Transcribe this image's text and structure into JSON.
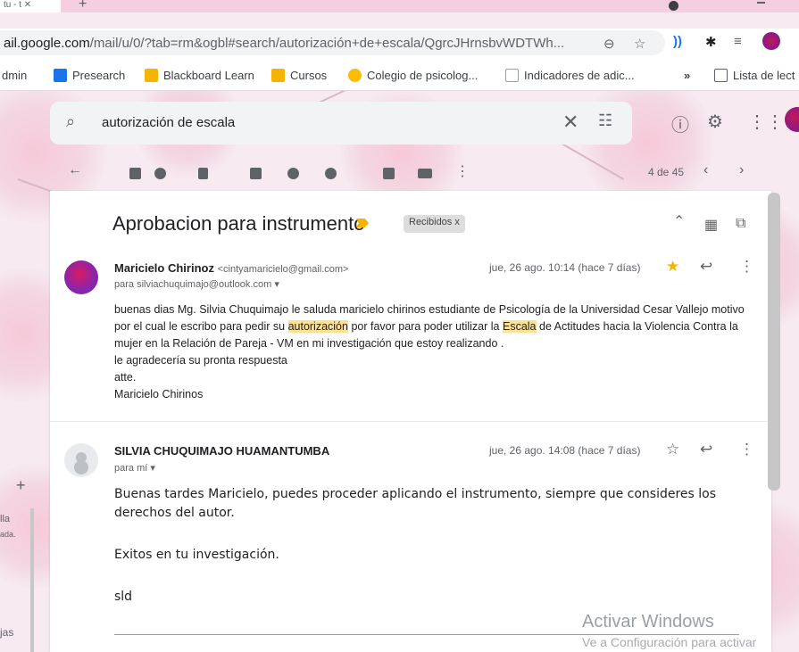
{
  "browser": {
    "tab_title": "tu - t",
    "url_host": "ail.google.com",
    "url_path": "/mail/u/0/?tab=rm&ogbl#search/autorización+de+escala/QgrcJHrnsbvWDTWh..."
  },
  "bookmarks": [
    {
      "label": "dmin",
      "color": "#ffffff"
    },
    {
      "label": "Presearch",
      "color": "#1a73e8"
    },
    {
      "label": "Blackboard Learn",
      "color": "#f4b400"
    },
    {
      "label": "Cursos",
      "color": "#f4b400"
    },
    {
      "label": "Colegio de psicolog...",
      "color": "#fbbc04"
    },
    {
      "label": "Indicadores de adic...",
      "color": "#5f6368"
    },
    {
      "label": "»",
      "color": "#ffffff"
    },
    {
      "label": "Lista de lect",
      "color": "#5f6368"
    }
  ],
  "search": {
    "query": "autorización de escala"
  },
  "toolbar": {
    "pager": "4 de 45"
  },
  "email": {
    "subject": "Aprobacion para instrumento",
    "label": "Recibidos x",
    "message1": {
      "sender_name": "Maricielo Chirinoz",
      "sender_email": "<cintyamaricielo@gmail.com>",
      "to": "para silviachuquimajo@outlook.com",
      "date": "jue, 26 ago. 10:14 (hace 7 días)",
      "body_a": "buenas dias Mg. Silvia Chuquimajo le saluda maricielo chirinos estudiante de Psicología de la Universidad Cesar Vallejo motivo por el cual le escribo para pedir su ",
      "hl1": "autorización",
      "body_b": " por favor para poder utilizar la  ",
      "hl2": "Escala",
      "body_c": " de Actitudes hacia la Violencia Contra la mujer en la Relación de Pareja - VM en mi investigación que estoy realizando .",
      "line2": " le agradecería su pronta respuesta",
      "line3": "atte.",
      "line4": "Maricielo Chirinos"
    },
    "message2": {
      "sender_name": "SILVIA CHUQUIMAJO HUAMANTUMBA",
      "to": "para mí",
      "date": "jue, 26 ago. 14:08 (hace 7 días)",
      "p1": "Buenas tardes Maricielo, puedes proceder aplicando el instrumento, siempre que consideres los derechos del autor.",
      "p2": "Exitos en tu investigación.",
      "p3": "sld"
    }
  },
  "left_sidebar": {
    "item1": "lla",
    "item2": "ada.",
    "item3": "jas"
  },
  "watermark": {
    "line1": "Activar Windows",
    "line2": "Ve a Configuración para activar"
  }
}
